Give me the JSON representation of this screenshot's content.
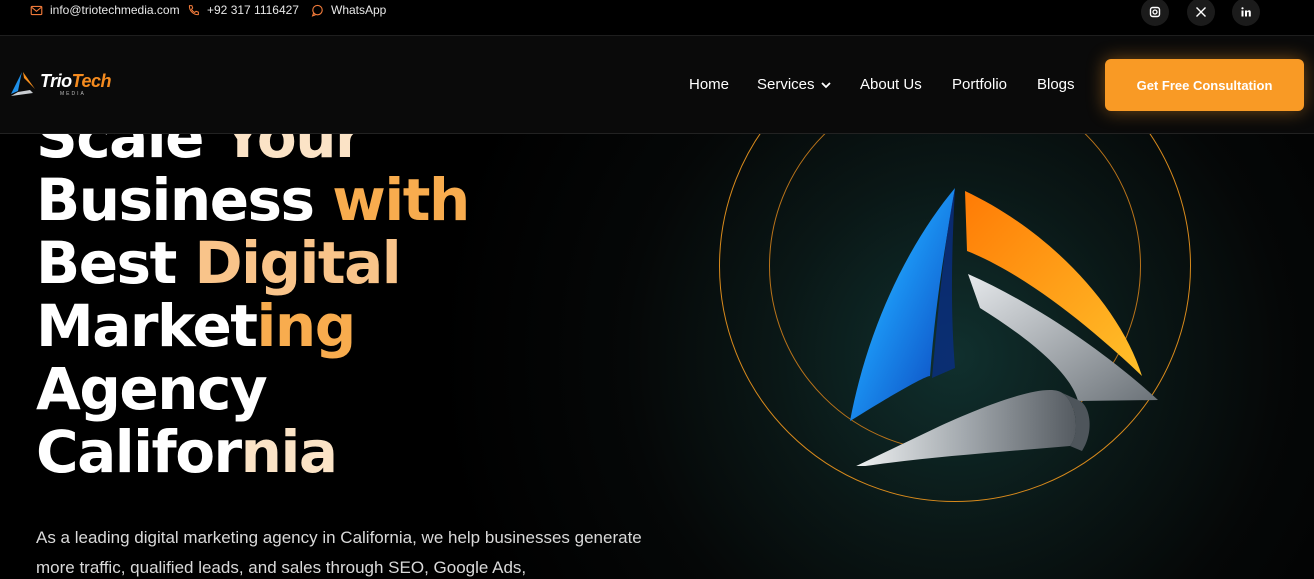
{
  "topbar": {
    "email": "info@triotechmedia.com",
    "phone": "+92 317 1116427",
    "whatsapp": "WhatsApp"
  },
  "navbar": {
    "logo_name_1": "Trio",
    "logo_name_2": "Tech",
    "logo_sub": "MEDIA",
    "items": [
      {
        "label": "Home"
      },
      {
        "label": "Services"
      },
      {
        "label": "About Us"
      },
      {
        "label": "Portfolio"
      },
      {
        "label": "Blogs"
      }
    ],
    "cta_label": "Get Free Consultation"
  },
  "hero": {
    "headline": {
      "l1a": "Scale ",
      "l1b": "Your",
      "l2a": "Business ",
      "l2b": "with",
      "l3a": "Best ",
      "l3b": "Digital",
      "l4a": "Market",
      "l4b": "ing",
      "l5": "Agency",
      "l6a": "Califor",
      "l6b": "nia"
    },
    "paragraph": "As a leading digital marketing agency in California, we help businesses generate more traffic, qualified leads, and sales through SEO, Google Ads,"
  },
  "colors": {
    "accent": "#f99a25",
    "ring": "#d88a1c",
    "background": "#000000"
  }
}
